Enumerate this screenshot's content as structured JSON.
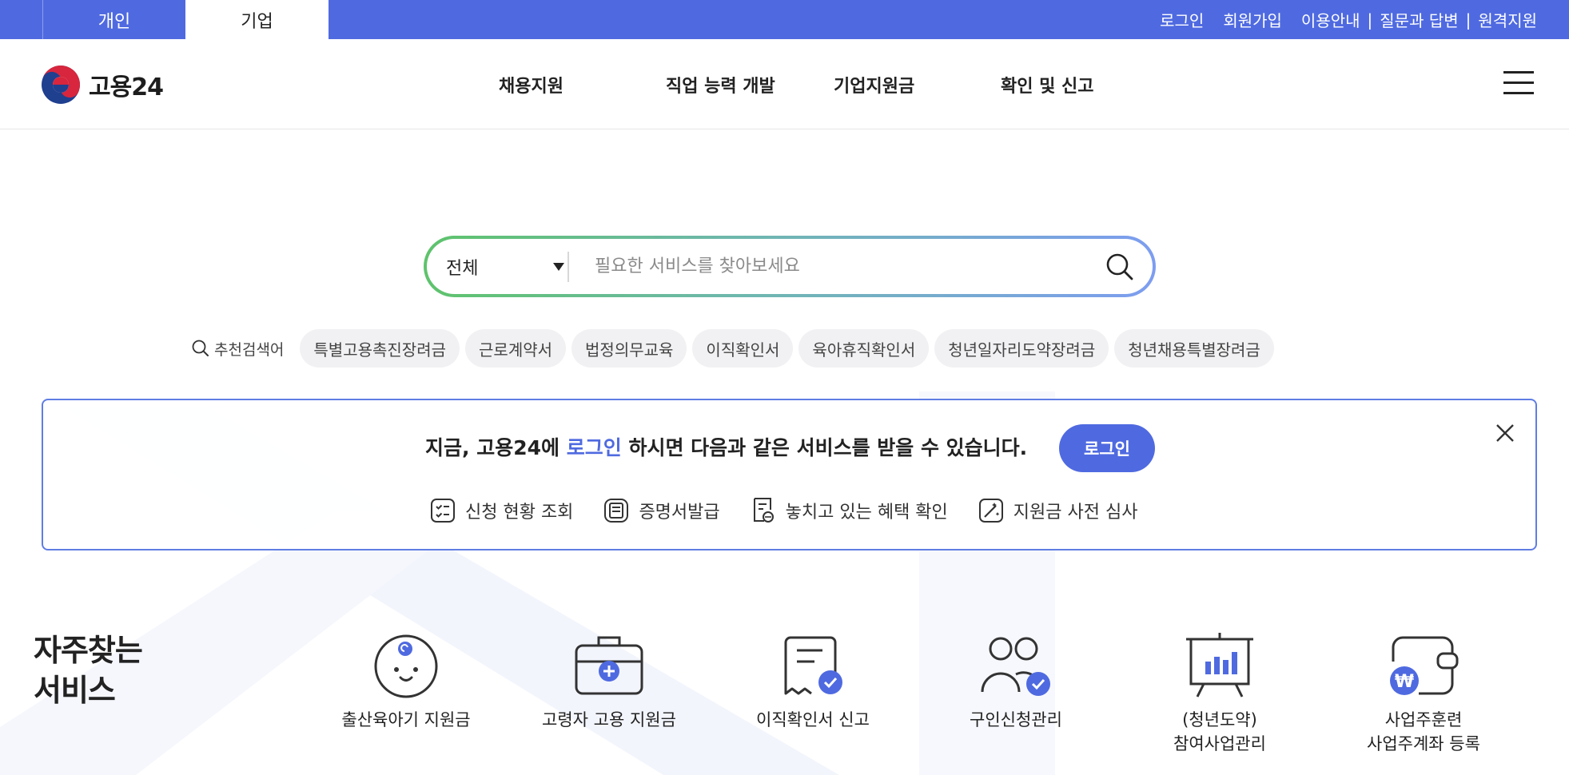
{
  "topbar": {
    "tabs": [
      {
        "label": "개인",
        "active": false
      },
      {
        "label": "기업",
        "active": true
      }
    ],
    "links": {
      "login": "로그인",
      "signup": "회원가입",
      "guide": "이용안내",
      "qna": "질문과 답변",
      "remote": "원격지원",
      "separator": "|"
    },
    "accent": "#4f6ae0"
  },
  "header": {
    "logo_text": "고용24",
    "nav": [
      "채용지원",
      "직업 능력 개발",
      "기업지원금",
      "확인 및 신고"
    ],
    "menu_icon": "hamburger-menu-icon"
  },
  "search": {
    "category": "전체",
    "placeholder": "필요한 서비스를 찾아보세요",
    "value": "",
    "icon": "search-icon"
  },
  "keywords": {
    "label": "추천검색어",
    "items": [
      "특별고용촉진장려금",
      "근로계약서",
      "법정의무교육",
      "이직확인서",
      "육아휴직확인서",
      "청년일자리도약장려금",
      "청년채용특별장려금"
    ]
  },
  "login_banner": {
    "text_before": "지금, 고용24에",
    "text_highlight": "로그인",
    "text_after": "하시면 다음과 같은 서비스를 받을 수 있습니다.",
    "button": "로그인",
    "close_icon": "close-icon",
    "services": [
      {
        "label": "신청 현황 조회",
        "icon": "checklist-icon"
      },
      {
        "label": "증명서발급",
        "icon": "certificate-icon"
      },
      {
        "label": "놓치고 있는 혜택 확인",
        "icon": "benefit-search-icon"
      },
      {
        "label": "지원금 사전 심사",
        "icon": "pre-review-icon"
      }
    ]
  },
  "frequent": {
    "title_line1": "자주찾는",
    "title_line2": "서비스",
    "items": [
      {
        "label": "출산육아기 지원금",
        "icon": "baby-icon"
      },
      {
        "label": "고령자 고용 지원금",
        "icon": "briefcase-plus-icon"
      },
      {
        "label": "이직확인서 신고",
        "icon": "document-check-icon"
      },
      {
        "label": "구인신청관리",
        "icon": "people-check-icon"
      },
      {
        "label": "(청년도약)\n참여사업관리",
        "icon": "presentation-chart-icon"
      },
      {
        "label": "사업주훈련\n사업주계좌 등록",
        "icon": "wallet-won-icon"
      }
    ]
  }
}
